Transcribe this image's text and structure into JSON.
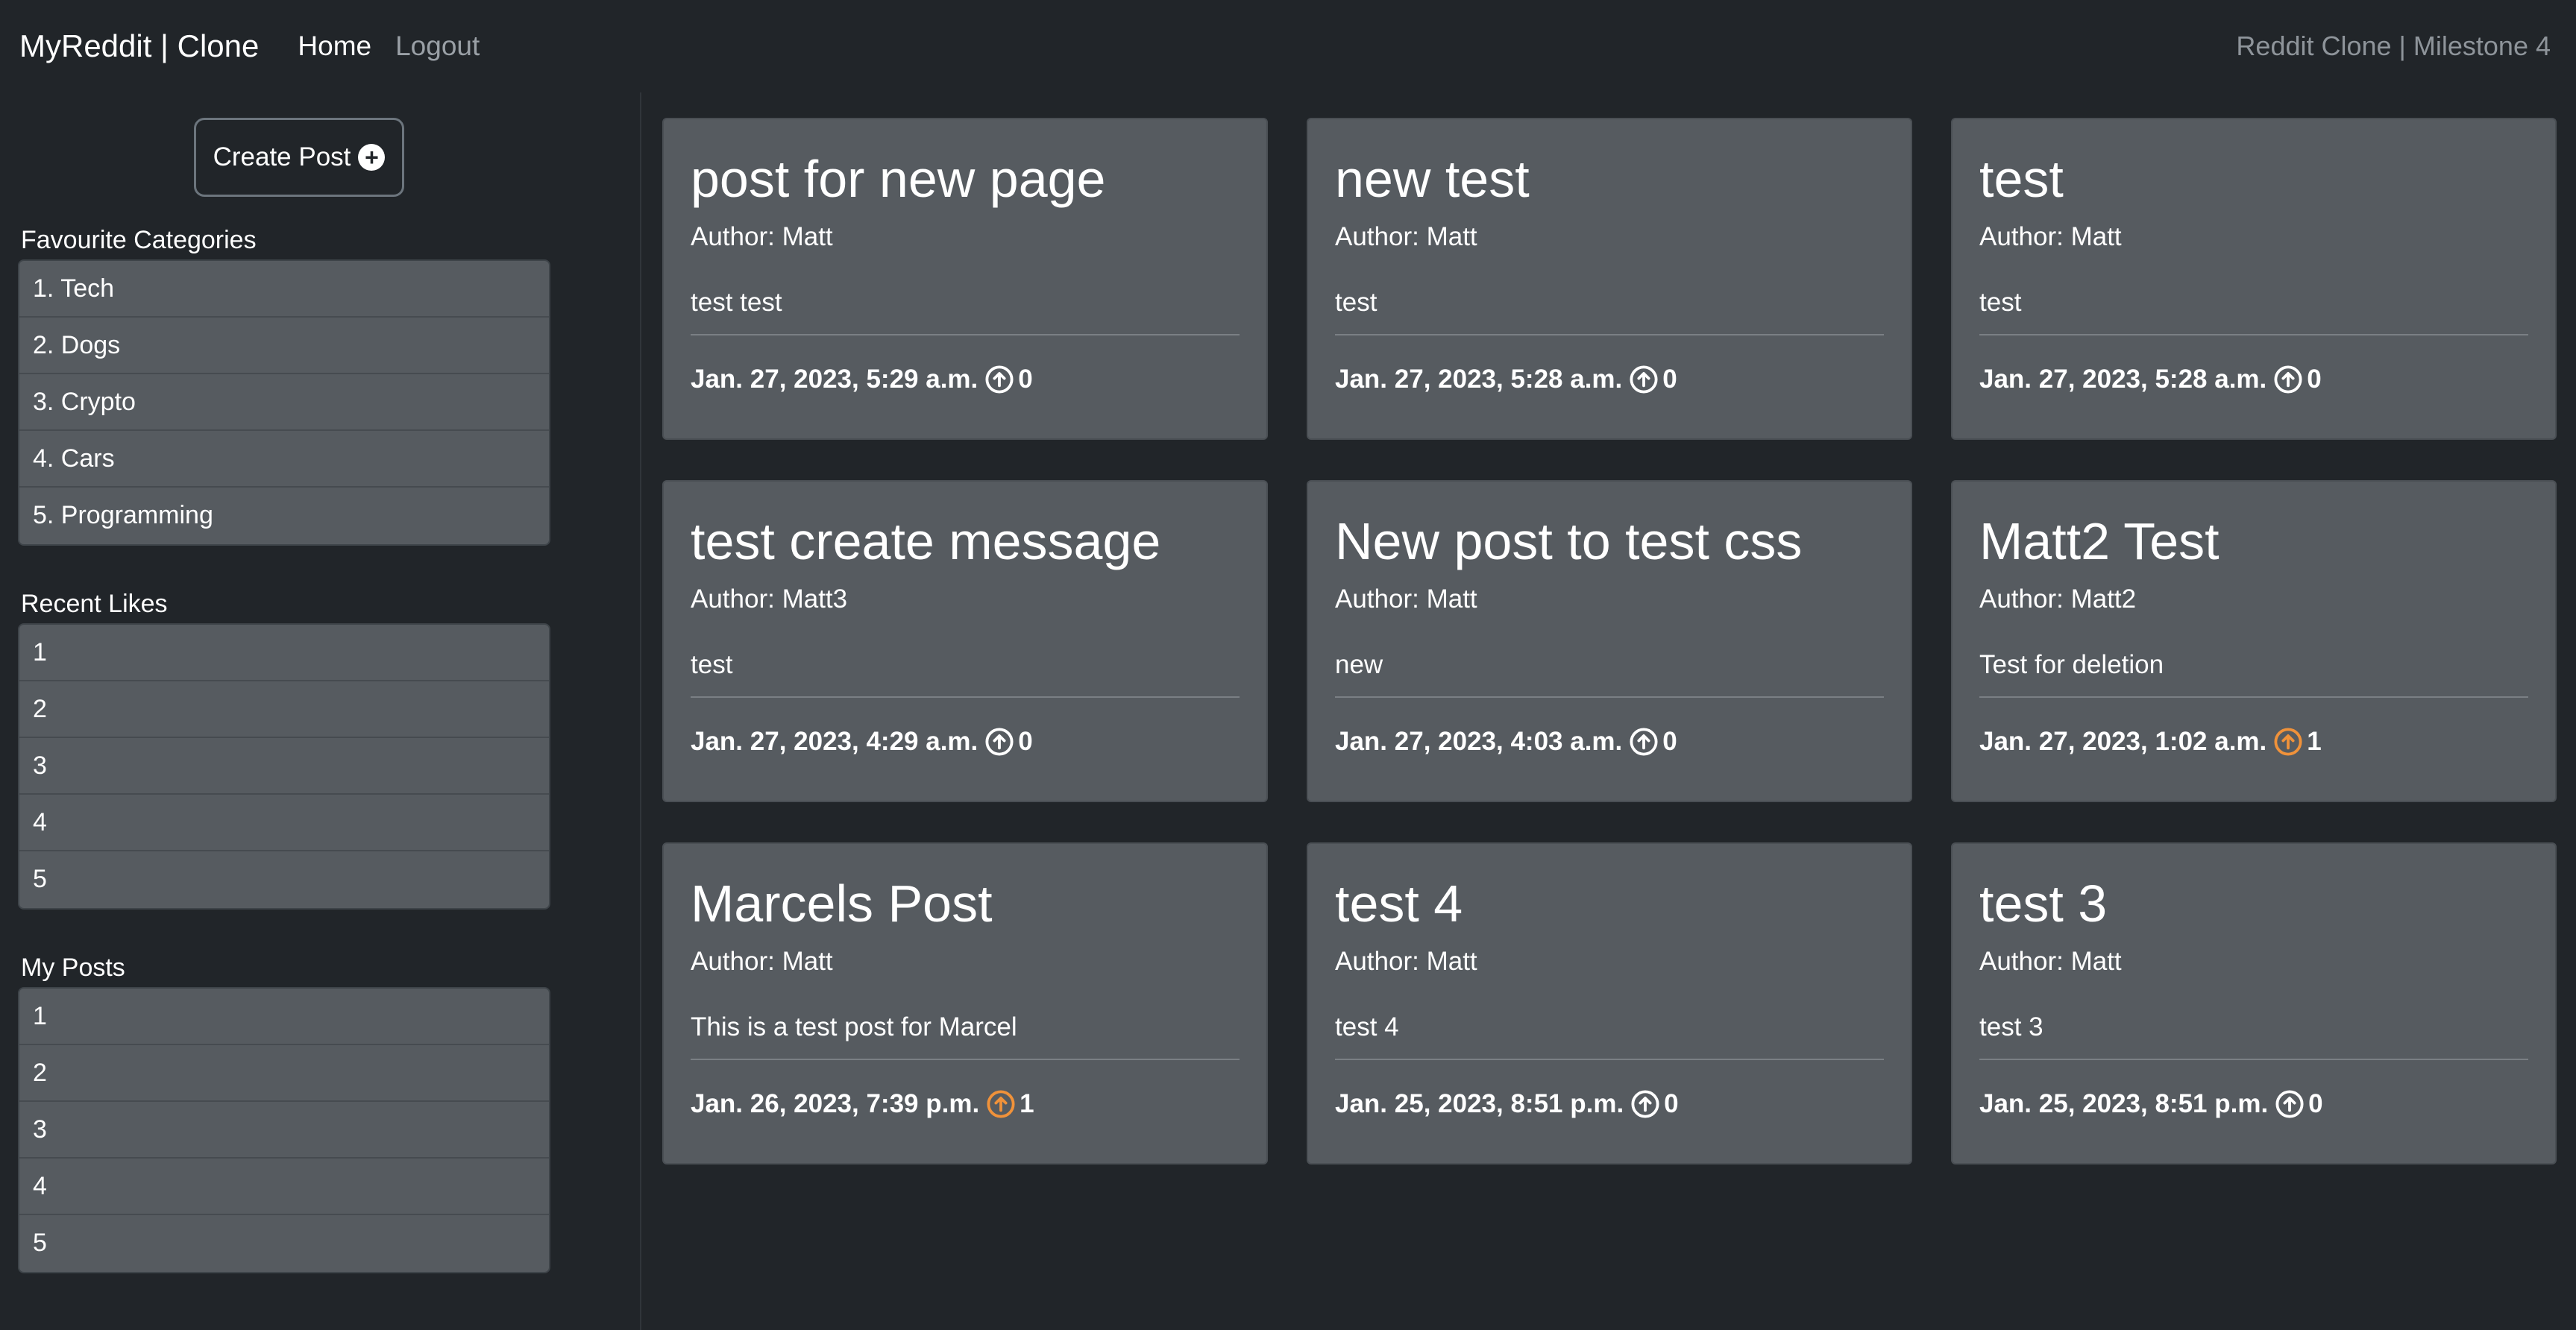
{
  "navbar": {
    "brand": "MyReddit | Clone",
    "links": [
      {
        "label": "Home",
        "active": true
      },
      {
        "label": "Logout",
        "active": false
      }
    ],
    "right_text": "Reddit Clone | Milestone 4"
  },
  "sidebar": {
    "create_post_label": "Create Post",
    "favourite_categories": {
      "heading": "Favourite Categories",
      "items": [
        "1. Tech",
        "2. Dogs",
        "3. Crypto",
        "4. Cars",
        "5. Programming"
      ]
    },
    "recent_likes": {
      "heading": "Recent Likes",
      "items": [
        "1",
        "2",
        "3",
        "4",
        "5"
      ]
    },
    "my_posts": {
      "heading": "My Posts",
      "items": [
        "1",
        "2",
        "3",
        "4",
        "5"
      ]
    }
  },
  "posts": [
    {
      "title": "post for new page",
      "author": "Author: Matt",
      "body": "test test",
      "date": "Jan. 27, 2023, 5:29 a.m.",
      "likes": "0",
      "liked": false
    },
    {
      "title": "new test",
      "author": "Author: Matt",
      "body": "test",
      "date": "Jan. 27, 2023, 5:28 a.m.",
      "likes": "0",
      "liked": false
    },
    {
      "title": "test",
      "author": "Author: Matt",
      "body": "test",
      "date": "Jan. 27, 2023, 5:28 a.m.",
      "likes": "0",
      "liked": false
    },
    {
      "title": "test create message",
      "author": "Author: Matt3",
      "body": "test",
      "date": "Jan. 27, 2023, 4:29 a.m.",
      "likes": "0",
      "liked": false
    },
    {
      "title": "New post to test css",
      "author": "Author: Matt",
      "body": "new",
      "date": "Jan. 27, 2023, 4:03 a.m.",
      "likes": "0",
      "liked": false
    },
    {
      "title": "Matt2 Test",
      "author": "Author: Matt2",
      "body": "Test for deletion",
      "date": "Jan. 27, 2023, 1:02 a.m.",
      "likes": "1",
      "liked": true
    },
    {
      "title": "Marcels Post",
      "author": "Author: Matt",
      "body": "This is a test post for Marcel",
      "date": "Jan. 26, 2023, 7:39 p.m.",
      "likes": "1",
      "liked": true
    },
    {
      "title": "test 4",
      "author": "Author: Matt",
      "body": "test 4",
      "date": "Jan. 25, 2023, 8:51 p.m.",
      "likes": "0",
      "liked": false
    },
    {
      "title": "test 3",
      "author": "Author: Matt",
      "body": "test 3",
      "date": "Jan. 25, 2023, 8:51 p.m.",
      "likes": "0",
      "liked": false
    }
  ],
  "colors": {
    "background": "#212529",
    "card": "#565b60",
    "liked_icon": "#f0923a",
    "unliked_icon": "#ffffff"
  },
  "icons": {
    "create_post": "plus-circle-icon",
    "upvote": "arrow-up-circle-icon"
  }
}
